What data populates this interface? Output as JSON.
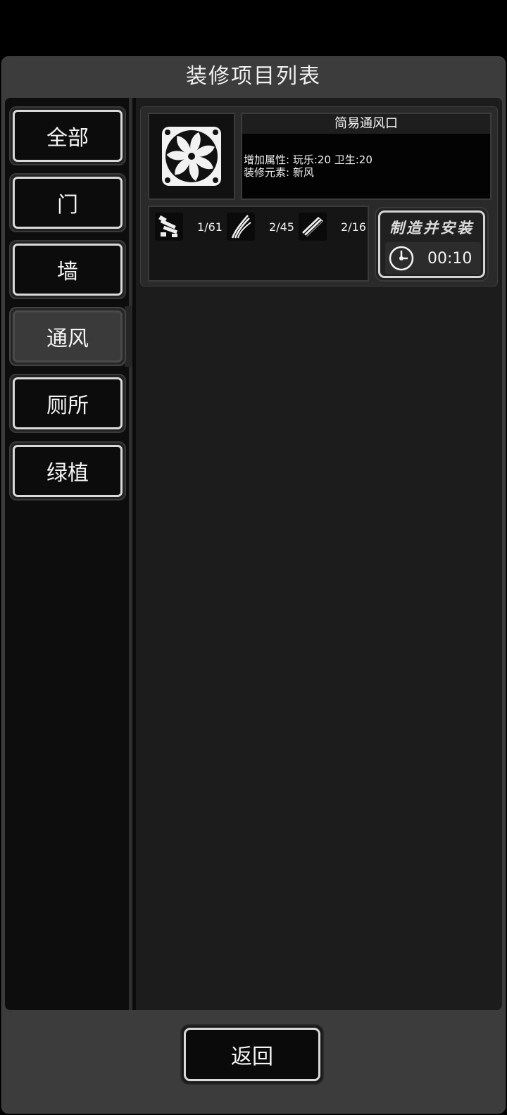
{
  "panel": {
    "title": "装修项目列表"
  },
  "sidebar": {
    "items": [
      {
        "label": "全部",
        "active": false
      },
      {
        "label": "门",
        "active": false
      },
      {
        "label": "墙",
        "active": false
      },
      {
        "label": "通风",
        "active": true
      },
      {
        "label": "厕所",
        "active": false
      },
      {
        "label": "绿植",
        "active": false
      }
    ]
  },
  "item": {
    "icon": "fan-icon",
    "name": "简易通风口",
    "attributes": "增加属性: 玩乐:20 卫生:20",
    "elements": "装修元素: 新风",
    "resources": [
      {
        "icon": "pipe-parts-icon",
        "count": "1/61"
      },
      {
        "icon": "wire-icon",
        "count": "2/45"
      },
      {
        "icon": "plank-icon",
        "count": "2/16"
      }
    ],
    "craft": {
      "label": "制造并安装",
      "icon": "clock-icon",
      "time": "00:10"
    }
  },
  "footer": {
    "return_label": "返回"
  }
}
